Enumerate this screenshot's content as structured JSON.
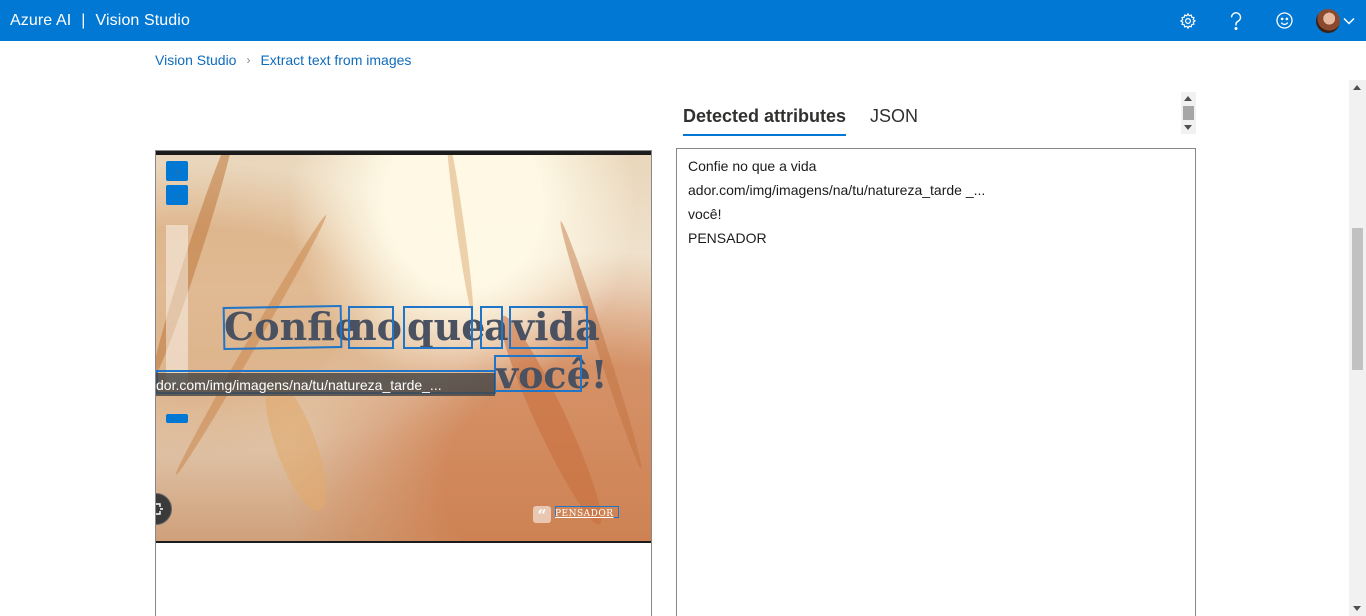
{
  "header": {
    "product": "Azure AI",
    "separator": "|",
    "app_name": "Vision Studio",
    "icons": [
      "gear-icon",
      "help-icon",
      "smiley-icon",
      "avatar",
      "chevron-down-icon"
    ]
  },
  "breadcrumb": {
    "home": "Vision Studio",
    "current": "Extract text from images"
  },
  "tabs": [
    {
      "label": "Detected attributes",
      "active": true
    },
    {
      "label": "JSON",
      "active": false
    }
  ],
  "image": {
    "zoom_in": "+",
    "zoom_out": "−",
    "words": [
      "Confie",
      "no",
      "que",
      "a",
      "vida",
      "você!"
    ],
    "tooltip": "dor.com/img/imagens/na/tu/natureza_tarde_...",
    "watermark": "PENSADOR"
  },
  "results": {
    "lines": [
      "Confie no que a vida",
      "ador.com/img/imagens/na/tu/natureza_tarde _...",
      "você!",
      "PENSADOR"
    ]
  },
  "colors": {
    "brand": "#0078d4",
    "link": "#0f6cbd",
    "bbox": "#1f75c7"
  }
}
